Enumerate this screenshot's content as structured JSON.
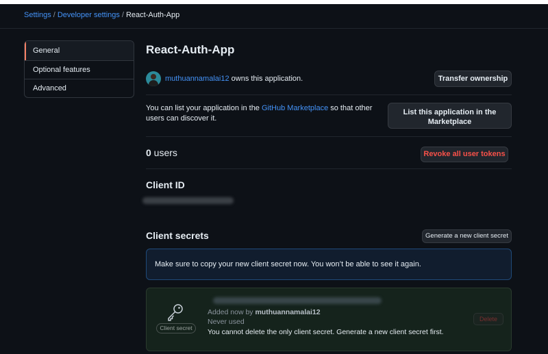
{
  "breadcrumb": {
    "settings": "Settings",
    "developer_settings": "Developer settings",
    "current": "React-Auth-App",
    "separator": "/"
  },
  "sidebar": {
    "items": [
      {
        "label": "General",
        "active": true
      },
      {
        "label": "Optional features",
        "active": false
      },
      {
        "label": "Advanced",
        "active": false
      }
    ]
  },
  "app": {
    "title": "React-Auth-App",
    "owner_name": "muthuannamalai12",
    "owner_suffix": " owns this application.",
    "transfer_label": "Transfer ownership"
  },
  "marketplace": {
    "text_before": "You can list your application in the ",
    "link": "GitHub Marketplace",
    "text_after": " so that other users can discover it.",
    "button_line1": "List this application in the",
    "button_line2": "Marketplace"
  },
  "users": {
    "count": "0",
    "label": " users",
    "revoke_label": "Revoke all user tokens"
  },
  "client_id": {
    "heading": "Client ID"
  },
  "client_secrets": {
    "heading": "Client secrets",
    "generate_label": "Generate a new client secret",
    "notice": "Make sure to copy your new client secret now. You won’t be able to see it again.",
    "badge": "Client secret",
    "added_prefix": "Added now by ",
    "added_by": "muthuannamalai12",
    "used": "Never used",
    "warning": "You cannot delete the only client secret. Generate a new client secret first.",
    "delete_label": "Delete"
  },
  "colors": {
    "background": "#0d1117",
    "link": "#4493f8",
    "danger": "#f85149",
    "active_indicator": "#f78166"
  }
}
